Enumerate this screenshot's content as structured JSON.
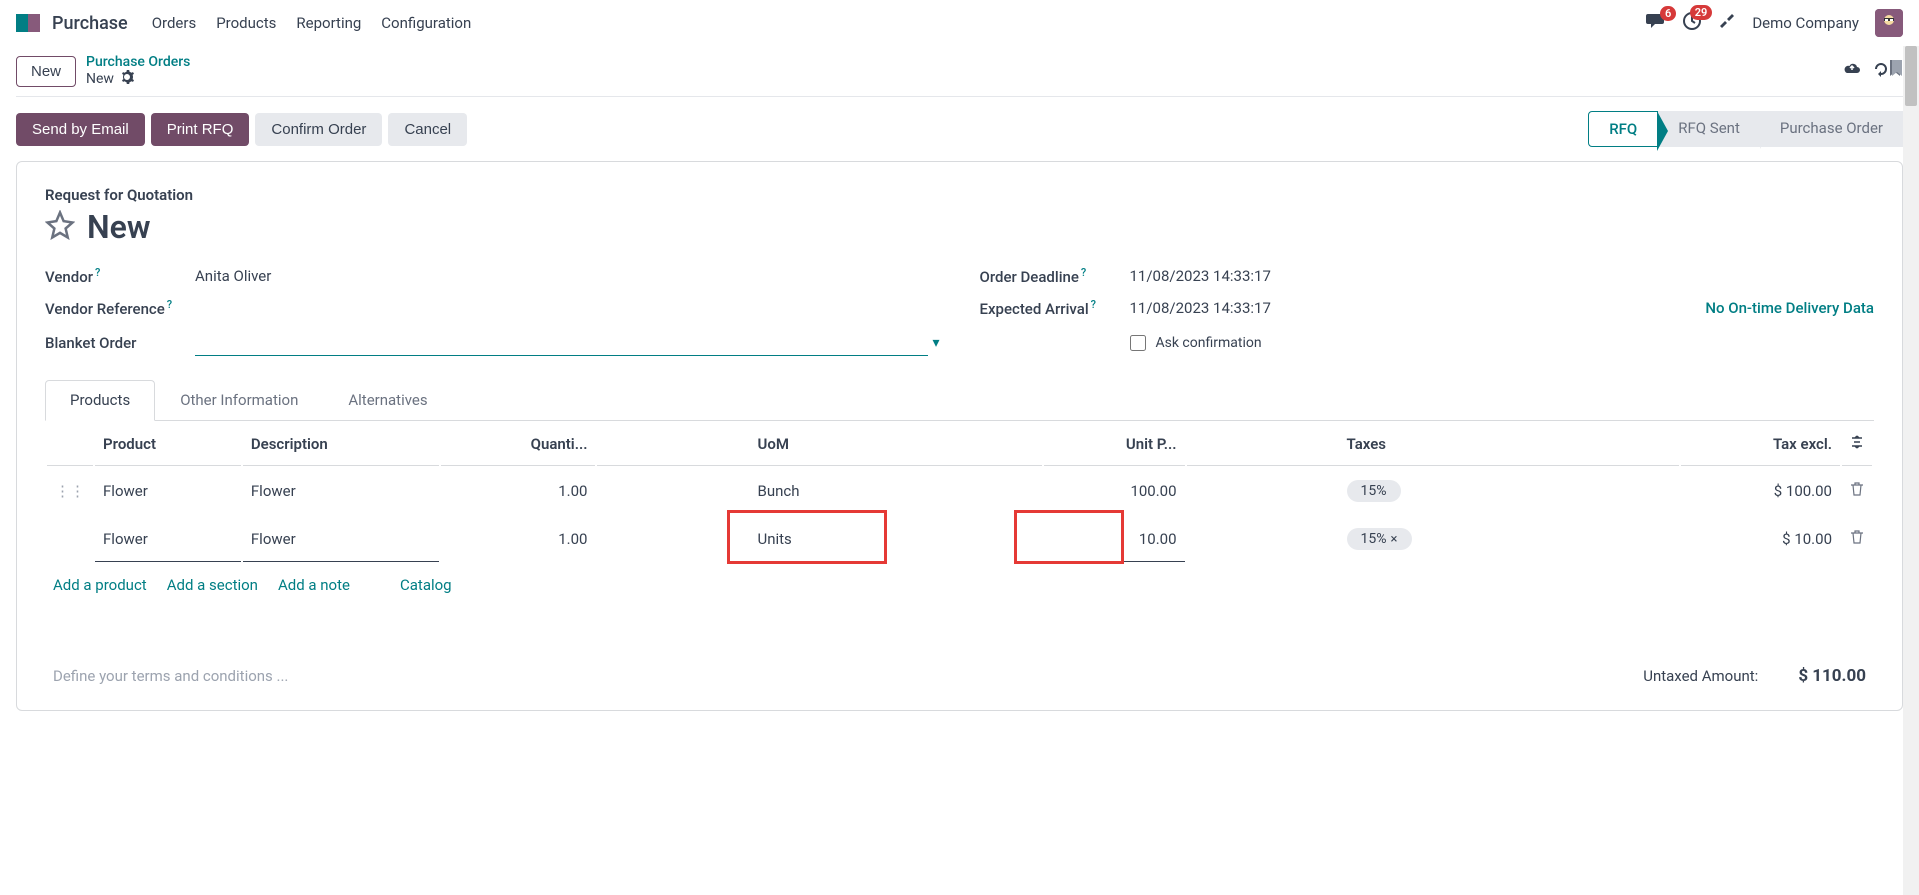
{
  "nav": {
    "app_name": "Purchase",
    "items": [
      "Orders",
      "Products",
      "Reporting",
      "Configuration"
    ],
    "chat_badge": "6",
    "clock_badge": "29",
    "company": "Demo Company"
  },
  "subheader": {
    "new_btn": "New",
    "breadcrumb_link": "Purchase Orders",
    "breadcrumb_current": "New"
  },
  "actions": {
    "send_email": "Send by Email",
    "print_rfq": "Print RFQ",
    "confirm": "Confirm Order",
    "cancel": "Cancel"
  },
  "status": {
    "rfq": "RFQ",
    "rfq_sent": "RFQ Sent",
    "purchase_order": "Purchase Order"
  },
  "form": {
    "title_label": "Request for Quotation",
    "title": "New",
    "vendor_label": "Vendor",
    "vendor_value": "Anita Oliver",
    "vendor_ref_label": "Vendor Reference",
    "blanket_label": "Blanket Order",
    "deadline_label": "Order Deadline",
    "deadline_value": "11/08/2023 14:33:17",
    "expected_label": "Expected Arrival",
    "expected_value": "11/08/2023 14:33:17",
    "delivery_link": "No On-time Delivery Data",
    "ask_confirm": "Ask confirmation"
  },
  "tabs": {
    "products": "Products",
    "other": "Other Information",
    "alternatives": "Alternatives"
  },
  "table": {
    "headers": {
      "product": "Product",
      "description": "Description",
      "quantity": "Quanti...",
      "uom": "UoM",
      "unit_price": "Unit P...",
      "taxes": "Taxes",
      "tax_excl": "Tax excl."
    },
    "rows": [
      {
        "product": "Flower",
        "description": "Flower",
        "quantity": "1.00",
        "uom": "Bunch",
        "unit_price": "100.00",
        "taxes": "15%",
        "tax_excl": "$ 100.00"
      },
      {
        "product": "Flower",
        "description": "Flower",
        "quantity": "1.00",
        "uom": "Units",
        "unit_price": "10.00",
        "taxes": "15%",
        "tax_excl": "$ 10.00"
      }
    ]
  },
  "add_links": {
    "product": "Add a product",
    "section": "Add a section",
    "note": "Add a note",
    "catalog": "Catalog"
  },
  "footer": {
    "terms_placeholder": "Define your terms and conditions ...",
    "untaxed_label": "Untaxed Amount:",
    "untaxed_amount": "$ 110.00"
  }
}
